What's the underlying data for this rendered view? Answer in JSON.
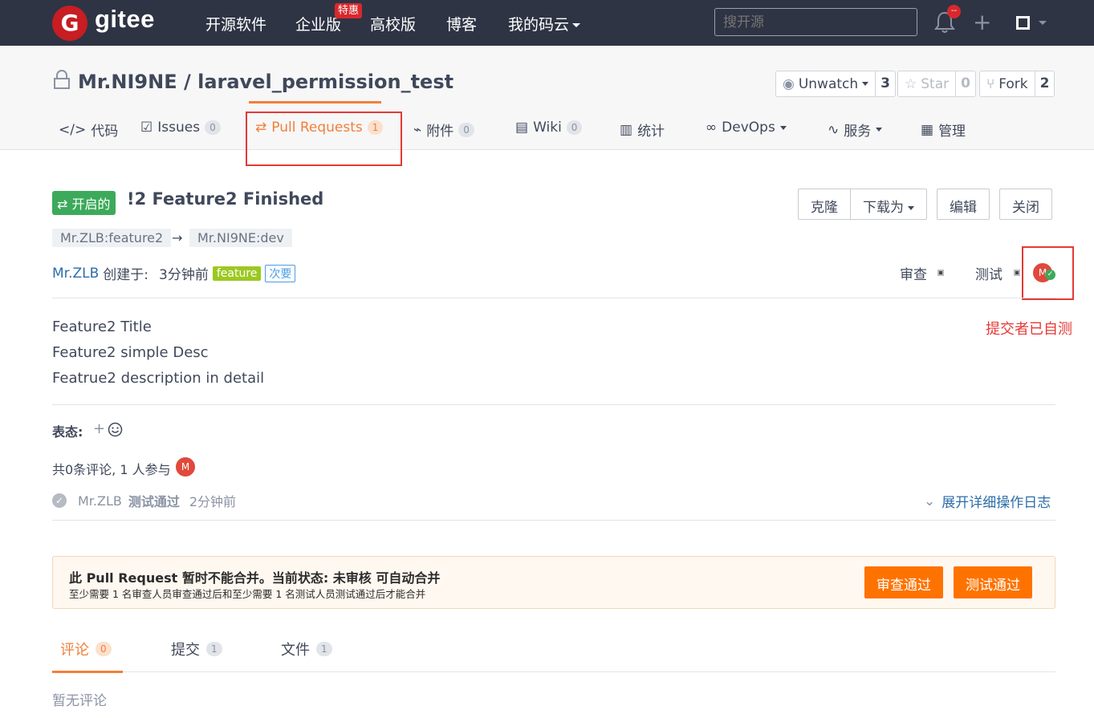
{
  "topnav": {
    "logo_letter": "G",
    "logo_text": "gitee",
    "items": [
      "开源软件",
      "企业版",
      "高校版",
      "博客",
      "我的码云"
    ],
    "enterprise_badge": "特惠",
    "search_placeholder": "搜开源",
    "notif_badge": "--"
  },
  "project": {
    "title": "Mr.NI9NE / laravel_permission_test",
    "watch": {
      "label": "Unwatch",
      "count": "3"
    },
    "star": {
      "label": "Star",
      "count": "0"
    },
    "fork": {
      "label": "Fork",
      "count": "2"
    },
    "tabs": [
      {
        "label": "代码",
        "count": ""
      },
      {
        "label": "Issues",
        "count": "0"
      },
      {
        "label": "Pull Requests",
        "count": "1"
      },
      {
        "label": "附件",
        "count": "0"
      },
      {
        "label": "Wiki",
        "count": "0"
      },
      {
        "label": "统计",
        "count": ""
      },
      {
        "label": "DevOps",
        "count": ""
      },
      {
        "label": "服务",
        "count": ""
      },
      {
        "label": "管理",
        "count": ""
      }
    ]
  },
  "pr": {
    "status": "开启的",
    "title": "!2 Feature2 Finished",
    "actions": {
      "clone": "克隆",
      "download": "下载为",
      "edit": "编辑",
      "close": "关闭"
    },
    "source_branch": "Mr.ZLB:feature2",
    "arrow": "→",
    "target_branch": "Mr.NI9NE:dev",
    "author": "Mr.ZLB",
    "created_label": "创建于:",
    "created_time": "3分钟前",
    "label_feature": "feature",
    "label_priority": "次要",
    "reviewer_label": "审查",
    "tester_label": "测试",
    "tester_avatar": "M",
    "annotation": "提交者已自测",
    "description": [
      "Feature2 Title",
      "Feature2 simple Desc",
      "Featrue2 description in detail"
    ],
    "reactions_label": "表态:",
    "reactions_add": "+",
    "comment_summary": "共0条评论, 1 人参与",
    "participant_avatar": "M",
    "log": {
      "user": "Mr.ZLB",
      "action": "测试通过",
      "time": "2分钟前"
    },
    "expand_log": "展开详细操作日志"
  },
  "merge": {
    "title": "此 Pull Request 暂时不能合并。当前状态: 未审核 可自动合并",
    "subtitle": "至少需要 1 名审查人员审查通过后和至少需要 1 名测试人员测试通过后才能合并",
    "review_button": "审查通过",
    "test_button": "测试通过"
  },
  "bottom_tabs": [
    {
      "label": "评论",
      "count": "0"
    },
    {
      "label": "提交",
      "count": "1"
    },
    {
      "label": "文件",
      "count": "1"
    }
  ],
  "no_comment": "暂无评论",
  "colors": {
    "accent": "#f1803b",
    "nav_bg": "#2e3444",
    "open_green": "#3caa5a",
    "merge_button": "#fe7300",
    "annotation_red": "#e53935"
  }
}
